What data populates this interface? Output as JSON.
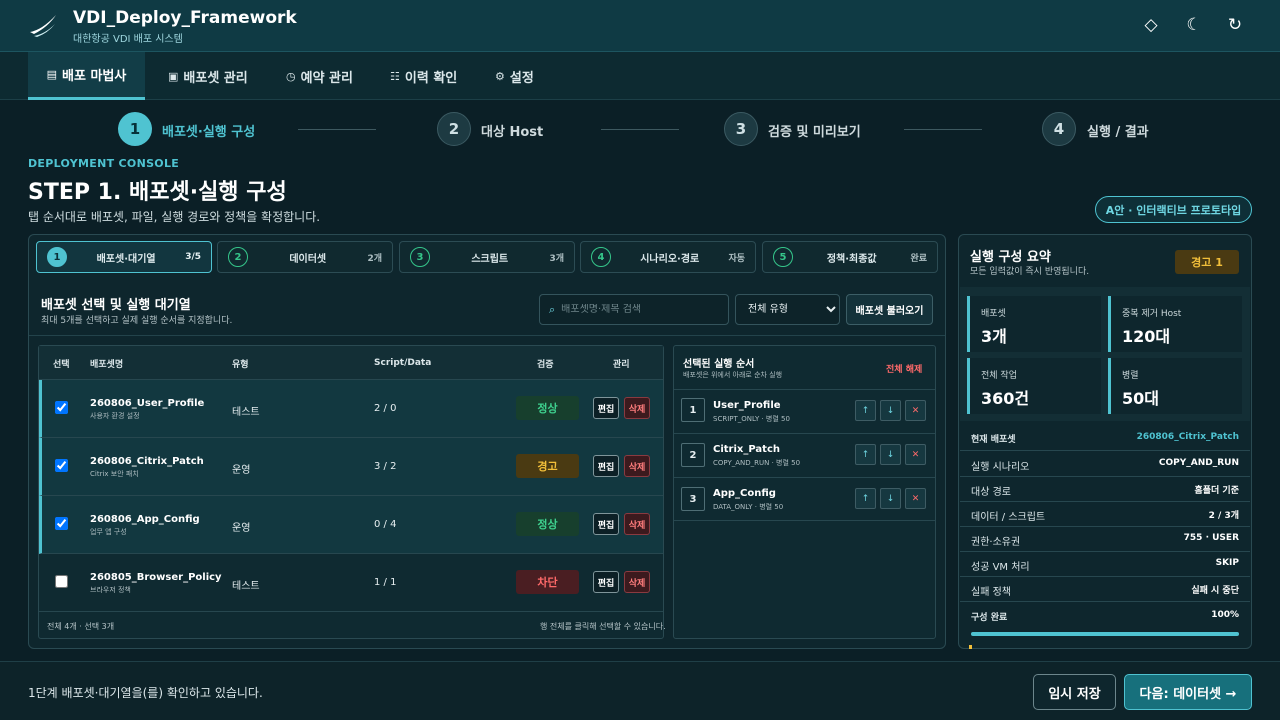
{
  "header": {
    "title": "VDI_Deploy_Framework",
    "subtitle": "대한항공 VDI 배포 시스템",
    "icons": [
      "diamond-icon",
      "moon-icon",
      "refresh-icon"
    ]
  },
  "tabs": [
    {
      "label": "배포 마법사",
      "icon": "▤",
      "active": true
    },
    {
      "label": "배포셋 관리",
      "icon": "▣"
    },
    {
      "label": "예약 관리",
      "icon": "◷"
    },
    {
      "label": "이력 확인",
      "icon": "☷"
    },
    {
      "label": "설정",
      "icon": "⚙"
    }
  ],
  "stepper": [
    {
      "num": "1",
      "label": "배포셋·실행 구성",
      "active": true
    },
    {
      "num": "2",
      "label": "대상 Host"
    },
    {
      "num": "3",
      "label": "검증 및 미리보기"
    },
    {
      "num": "4",
      "label": "실행 / 결과"
    }
  ],
  "page": {
    "eyebrow": "DEPLOYMENT CONSOLE",
    "title": "STEP 1. 배포셋·실행 구성",
    "subtitle": "탭 순서대로 배포셋, 파일, 실행 경로와 정책을 확정합니다.",
    "badge": "A안 · 인터랙티브 프로토타입"
  },
  "subtabs": [
    {
      "num": "1",
      "label": "배포셋·대기열",
      "meta": "3/5",
      "active": true
    },
    {
      "num": "2",
      "label": "데이터셋",
      "meta": "2개"
    },
    {
      "num": "3",
      "label": "스크립트",
      "meta": "3개"
    },
    {
      "num": "4",
      "label": "시나리오·경로",
      "meta": "자동"
    },
    {
      "num": "5",
      "label": "정책·최종값",
      "meta": "완료"
    }
  ],
  "section": {
    "title": "배포셋 선택 및 실행 대기열",
    "subtitle": "최대 5개를 선택하고 실제 실행 순서를 지정합니다.",
    "search_placeholder": "배포셋명·제목 검색",
    "filter_value": "전체 유형",
    "load_button": "배포셋 불러오기"
  },
  "table": {
    "headers": {
      "select": "선택",
      "name": "배포셋명",
      "type": "유형",
      "script": "Script/Data",
      "verify": "검증",
      "manage": "관리"
    },
    "edit_label": "편집",
    "delete_label": "삭제",
    "rows": [
      {
        "name": "260806_User_Profile",
        "desc": "사용자 환경 설정",
        "type": "테스트",
        "sd": "2 / 0",
        "status": "정상",
        "kind": "ok",
        "checked": true
      },
      {
        "name": "260806_Citrix_Patch",
        "desc": "Citrix 보안 패치",
        "type": "운영",
        "sd": "3 / 2",
        "status": "경고",
        "kind": "warn",
        "checked": true
      },
      {
        "name": "260806_App_Config",
        "desc": "업무 앱 구성",
        "type": "운영",
        "sd": "0 / 4",
        "status": "정상",
        "kind": "ok",
        "checked": true
      },
      {
        "name": "260805_Browser_Policy",
        "desc": "브라우저 정책",
        "type": "테스트",
        "sd": "1 / 1",
        "status": "차단",
        "kind": "block",
        "checked": false
      }
    ],
    "footer_left": "전체 4개 · 선택 3개",
    "footer_right": "행 전체를 클릭해 선택할 수 있습니다."
  },
  "order": {
    "title": "선택된 실행 순서",
    "subtitle": "배포셋은 위에서 아래로 순차 실행",
    "clear": "전체 해제",
    "items": [
      {
        "num": "1",
        "name": "User_Profile",
        "meta": "SCRIPT_ONLY · 병렬 50"
      },
      {
        "num": "2",
        "name": "Citrix_Patch",
        "meta": "COPY_AND_RUN · 병렬 50"
      },
      {
        "num": "3",
        "name": "App_Config",
        "meta": "DATA_ONLY · 병렬 50"
      }
    ]
  },
  "summary": {
    "title": "실행 구성 요약",
    "subtitle": "모든 입력값이 즉시 반영됩니다.",
    "warning": "경고 1",
    "stats": [
      {
        "label": "배포셋",
        "value": "3개"
      },
      {
        "label": "중복 제거 Host",
        "value": "120대"
      },
      {
        "label": "전체 작업",
        "value": "360건"
      },
      {
        "label": "병렬",
        "value": "50대"
      }
    ],
    "current_label": "현재 배포셋",
    "current_value": "260806_Citrix_Patch",
    "rows": [
      {
        "k": "실행 시나리오",
        "v": "COPY_AND_RUN"
      },
      {
        "k": "대상 경로",
        "v": "홈폴더 기준"
      },
      {
        "k": "데이터 / 스크립트",
        "v": "2 / 3개"
      },
      {
        "k": "권한·소유권",
        "v": "755 · USER"
      },
      {
        "k": "성공 VM 처리",
        "v": "SKIP"
      },
      {
        "k": "실패 정책",
        "v": "실패 시 중단"
      }
    ],
    "complete_label": "구성 완료",
    "complete_value": "100%",
    "complete_fraction": 1.0
  },
  "footer": {
    "status": "1단계 배포셋·대기열을(를) 확인하고 있습니다.",
    "save": "임시 저장",
    "next": "다음: 데이터셋 →"
  },
  "colors": {
    "accent": "#4fc3d1",
    "ok": "#3ed08e",
    "warn": "#f2bf3a",
    "block": "#ff6a6a"
  }
}
